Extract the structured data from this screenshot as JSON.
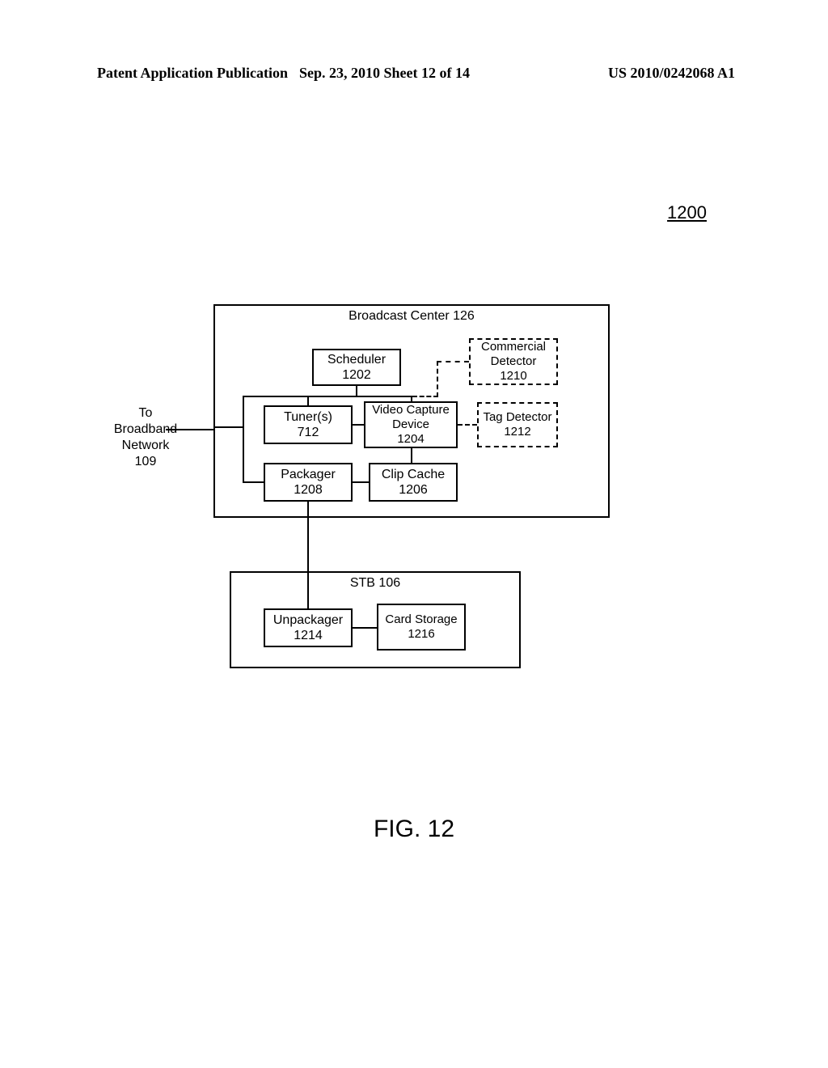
{
  "header": {
    "left": "Patent Application Publication",
    "center": "Sep. 23, 2010  Sheet 12 of 14",
    "right": "US 2010/0242068 A1"
  },
  "figure": {
    "number": "1200",
    "caption": "FIG. 12"
  },
  "external": {
    "label": "To\nBroadband\nNetwork\n109"
  },
  "broadcastCenter": {
    "title": "Broadcast Center 126",
    "scheduler": {
      "name": "Scheduler",
      "ref": "1202"
    },
    "commercial": {
      "name": "Commercial Detector",
      "ref": "1210"
    },
    "tuners": {
      "name": "Tuner(s)",
      "ref": "712"
    },
    "videoCapture": {
      "name": "Video Capture Device",
      "ref": "1204"
    },
    "tagDetector": {
      "name": "Tag Detector",
      "ref": "1212"
    },
    "packager": {
      "name": "Packager",
      "ref": "1208"
    },
    "clipCache": {
      "name": "Clip Cache",
      "ref": "1206"
    }
  },
  "stb": {
    "title": "STB 106",
    "unpackager": {
      "name": "Unpackager",
      "ref": "1214"
    },
    "cardStorage": {
      "name": "Card Storage",
      "ref": "1216"
    }
  }
}
